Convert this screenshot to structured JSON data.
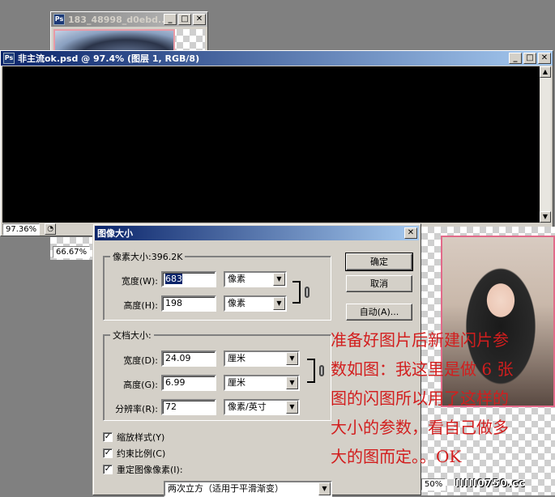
{
  "back_window": {
    "title": "183_48998_d0ebd...",
    "icon": "Ps"
  },
  "main_window": {
    "title": "非主流ok.psd @ 97.4% (图层 1, RGB/8)",
    "icon": "Ps",
    "zoom": "97.36%",
    "buttons": {
      "minimize": "_",
      "maximize": "□",
      "close": "✕"
    }
  },
  "small_zoom": "66.67%",
  "photo_window": {
    "zoom": "50%"
  },
  "dialog": {
    "title": "图像大小",
    "close": "✕",
    "pixel_dimensions": {
      "label": "像素大小:396.2K",
      "width_label": "宽度(W):",
      "width_value": "683",
      "width_unit": "像素",
      "height_label": "高度(H):",
      "height_value": "198",
      "height_unit": "像素"
    },
    "document_size": {
      "label": "文档大小:",
      "width_label": "宽度(D):",
      "width_value": "24.09",
      "width_unit": "厘米",
      "height_label": "高度(G):",
      "height_value": "6.99",
      "height_unit": "厘米",
      "resolution_label": "分辨率(R):",
      "resolution_value": "72",
      "resolution_unit": "像素/英寸"
    },
    "checkboxes": [
      {
        "label": "缩放样式(Y)",
        "checked": true
      },
      {
        "label": "约束比例(C)",
        "checked": true
      },
      {
        "label": "重定图像像素(I):",
        "checked": true
      }
    ],
    "resample_method": "两次立方（适用于平滑渐变）",
    "buttons": {
      "ok": "确定",
      "cancel": "取消",
      "auto": "自动(A)..."
    }
  },
  "annotation": {
    "color": "#d21e1e",
    "lines": [
      "准备好图片后新建闪片参",
      "数如图：我这里是做 6 张",
      "图的闪图所以用了这样的",
      "大小的参数，看自己做多",
      "大的图而定。。OK"
    ]
  },
  "watermark": "ⅠⅠⅠⅠⅠ0750.cc"
}
